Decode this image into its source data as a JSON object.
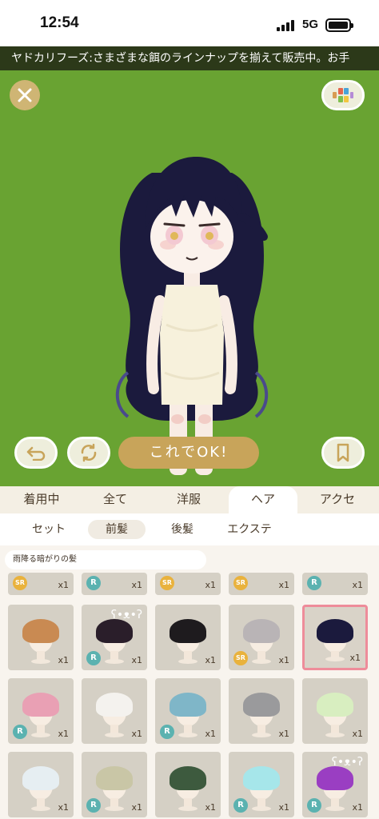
{
  "status": {
    "time": "12:54",
    "network": "5G"
  },
  "ticker": {
    "text": "ヤドカリフーズ:さまざまな餌のラインナップを揃えて販売中。お手"
  },
  "buttons": {
    "ok": "これでOK!"
  },
  "tabs": [
    {
      "label": "着用中"
    },
    {
      "label": "全て"
    },
    {
      "label": "洋服"
    },
    {
      "label": "ヘア"
    },
    {
      "label": "アクセ"
    }
  ],
  "subtabs": [
    {
      "label": "セット"
    },
    {
      "label": "前髪"
    },
    {
      "label": "後髪"
    },
    {
      "label": "エクステ"
    }
  ],
  "item_name": "雨降る暗がりの髪",
  "rarity_labels": {
    "r": "R",
    "sr": "SR"
  },
  "quantity": "x1",
  "icons": {
    "close": "close-icon",
    "palette": "color-palette-icon",
    "undo": "undo-icon",
    "rotate": "rotate-icon",
    "bookmark": "bookmark-icon"
  },
  "colors": {
    "stage_bg": "#69a332",
    "accent": "#c8a45a",
    "selected_border": "#ee8c9a"
  }
}
